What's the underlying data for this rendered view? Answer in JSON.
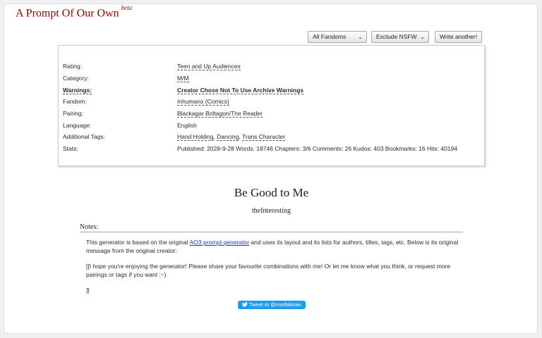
{
  "site": {
    "title": "A Prompt Of Our Own",
    "badge": "beta"
  },
  "controls": {
    "fandom_select": "All Fandoms",
    "rating_select": "Exclude NSFW",
    "write_button": "Write another!"
  },
  "meta": {
    "rating": {
      "label": "Rating:",
      "value": "Teen and Up Audiences"
    },
    "category": {
      "label": "Category:",
      "value": "M/M"
    },
    "warnings": {
      "label": "Warnings:",
      "value": "Creator Chose Not To Use Archive Warnings"
    },
    "fandom": {
      "label": "Fandom:",
      "value": "Inhumans (Comics)"
    },
    "pairing": {
      "label": "Pairing:",
      "value": "Blackagar Boltagon/The Reader"
    },
    "language": {
      "label": "Language:",
      "value": "English"
    },
    "tags": {
      "label": "Additional Tags:",
      "items": [
        "Hand Holding",
        "Dancing",
        "Trans Character"
      ],
      "sep": ", "
    },
    "stats": {
      "label": "Stats:",
      "published_label": "Published:",
      "published": "2028-9-28",
      "words_label": "Words:",
      "words": "18746",
      "chapters_label": "Chapters:",
      "chapters": "3/6",
      "comments_label": "Comments:",
      "comments": "26",
      "kudos_label": "Kudos:",
      "kudos": "403",
      "bookmarks_label": "Bookmarks:",
      "bookmarks": "16",
      "hits_label": "Hits:",
      "hits": "40194"
    }
  },
  "work": {
    "title": "Be Good to Me",
    "author": "theInteresting"
  },
  "notes": {
    "heading": "Notes:",
    "p1_before": "This generator is based on the original ",
    "p1_link": "AO3 prompt generator",
    "p1_after": " and uses its layout and its lists for authors, titles, tags, etc. Below is its original message from the original creator:",
    "p2": "[[I hope you're enjoying the generator! Please share your favourite combinations with me! Or let me know what you think, or request more pairings or tags if you want :~)",
    "p3": "]]"
  },
  "tweet": {
    "label": "Tweet to @morbitician"
  },
  "colors": {
    "title": "#990000",
    "link": "#1a3ad0",
    "tweet": "#1d9bf0"
  }
}
